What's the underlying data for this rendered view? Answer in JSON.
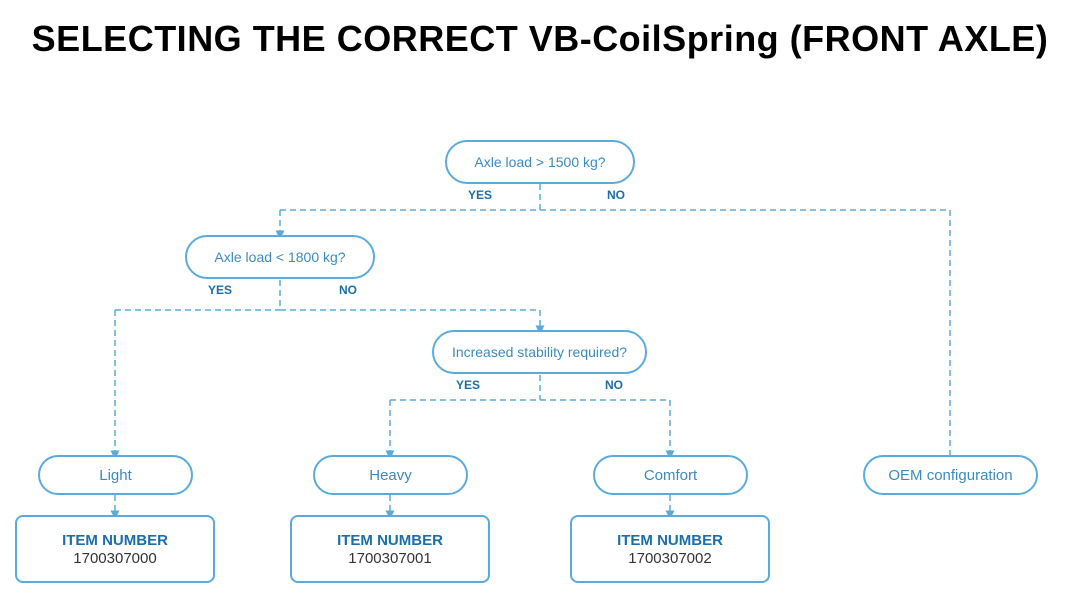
{
  "page": {
    "title": "SELECTING THE CORRECT VB-CoilSpring (FRONT AXLE)"
  },
  "decisions": {
    "d1": {
      "label": "Axle load > 1500 kg?",
      "yes": "YES",
      "no": "NO"
    },
    "d2": {
      "label": "Axle load < 1800 kg?",
      "yes": "YES",
      "no": "NO"
    },
    "d3": {
      "label": "Increased stability required?",
      "yes": "YES",
      "no": "NO"
    }
  },
  "results": {
    "light": "Light",
    "heavy": "Heavy",
    "comfort": "Comfort",
    "oem": "OEM configuration"
  },
  "items": {
    "item0": {
      "label": "ITEM NUMBER",
      "number": "1700307000"
    },
    "item1": {
      "label": "ITEM NUMBER",
      "number": "1700307001"
    },
    "item2": {
      "label": "ITEM NUMBER",
      "number": "1700307002"
    }
  },
  "colors": {
    "line": "#5aabdb",
    "text": "#1a6faa"
  }
}
